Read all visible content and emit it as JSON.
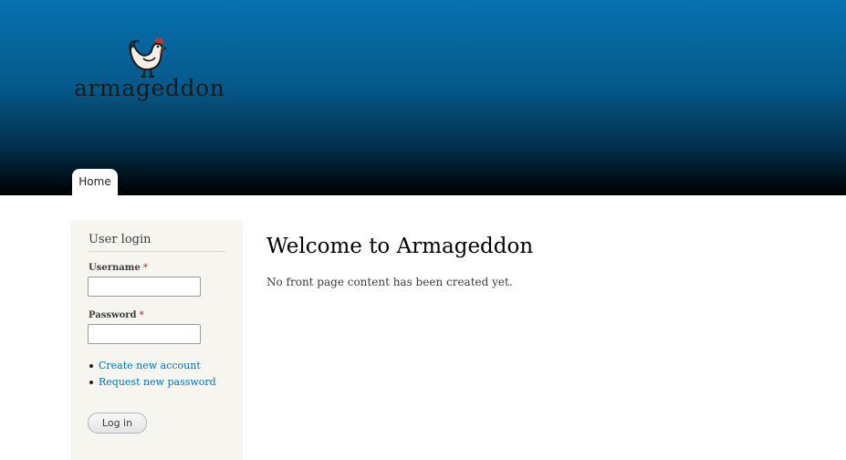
{
  "site": {
    "logo_text": "armageddon"
  },
  "nav": {
    "tabs": [
      {
        "label": "Home",
        "active": true
      }
    ]
  },
  "sidebar": {
    "block_title": "User login",
    "username_label": "Username",
    "password_label": "Password",
    "required_marker": "*",
    "links": [
      {
        "label": "Create new account"
      },
      {
        "label": "Request new password"
      }
    ],
    "login_button": "Log in"
  },
  "main": {
    "title": "Welcome to Armageddon",
    "text": "No front page content has been created yet."
  },
  "colors": {
    "header_top": "#0771b0",
    "header_bottom": "#000000",
    "link": "#0071b3",
    "required": "#e3322b",
    "sidebar_bg": "#f6f5f0"
  }
}
